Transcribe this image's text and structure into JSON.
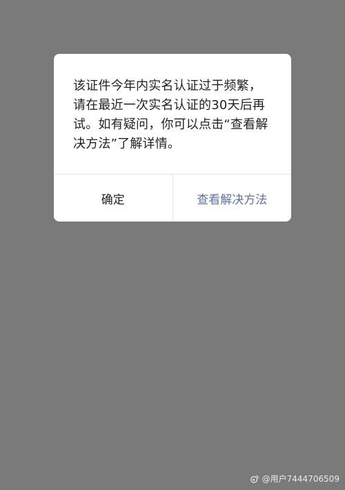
{
  "dialog": {
    "message": "该证件今年内实名认证过于频繁，请在最近一次实名认证的30天后再试。如有疑问，你可以点击“查看解决方法”了解详情。",
    "confirm_label": "确定",
    "solution_label": "查看解决方法"
  },
  "watermark": {
    "text": "@用户7444706509",
    "icon": "weibo-icon"
  },
  "colors": {
    "overlay": "#7a7a7a",
    "dialog_bg": "#ffffff",
    "text_primary": "#222222",
    "link": "#5a74a6",
    "divider": "#e4e4e4"
  }
}
